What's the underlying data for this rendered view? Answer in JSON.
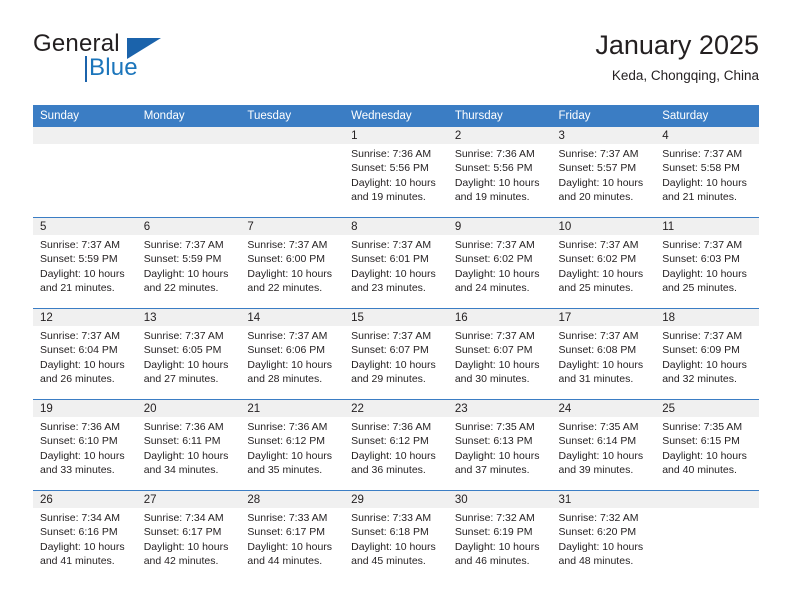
{
  "brand": {
    "word_general": "General",
    "word_blue": "Blue",
    "accent_color": "#1b75bb"
  },
  "header": {
    "title": "January 2025",
    "subtitle": "Keda, Chongqing, China"
  },
  "theme": {
    "header_bg": "#3b7dc4",
    "daynum_bg": "#f0f0f0",
    "text": "#231f20"
  },
  "weekday_headers": [
    "Sunday",
    "Monday",
    "Tuesday",
    "Wednesday",
    "Thursday",
    "Friday",
    "Saturday"
  ],
  "labels": {
    "sunrise_prefix": "Sunrise:",
    "sunset_prefix": "Sunset:",
    "daylight_prefix": "Daylight:"
  },
  "weeks": [
    [
      {
        "day": "",
        "sunrise": "",
        "sunset": "",
        "daylight": "",
        "empty": true
      },
      {
        "day": "",
        "sunrise": "",
        "sunset": "",
        "daylight": "",
        "empty": true
      },
      {
        "day": "",
        "sunrise": "",
        "sunset": "",
        "daylight": "",
        "empty": true
      },
      {
        "day": "1",
        "sunrise": "Sunrise: 7:36 AM",
        "sunset": "Sunset: 5:56 PM",
        "daylight": "Daylight: 10 hours and 19 minutes."
      },
      {
        "day": "2",
        "sunrise": "Sunrise: 7:36 AM",
        "sunset": "Sunset: 5:56 PM",
        "daylight": "Daylight: 10 hours and 19 minutes."
      },
      {
        "day": "3",
        "sunrise": "Sunrise: 7:37 AM",
        "sunset": "Sunset: 5:57 PM",
        "daylight": "Daylight: 10 hours and 20 minutes."
      },
      {
        "day": "4",
        "sunrise": "Sunrise: 7:37 AM",
        "sunset": "Sunset: 5:58 PM",
        "daylight": "Daylight: 10 hours and 21 minutes."
      }
    ],
    [
      {
        "day": "5",
        "sunrise": "Sunrise: 7:37 AM",
        "sunset": "Sunset: 5:59 PM",
        "daylight": "Daylight: 10 hours and 21 minutes."
      },
      {
        "day": "6",
        "sunrise": "Sunrise: 7:37 AM",
        "sunset": "Sunset: 5:59 PM",
        "daylight": "Daylight: 10 hours and 22 minutes."
      },
      {
        "day": "7",
        "sunrise": "Sunrise: 7:37 AM",
        "sunset": "Sunset: 6:00 PM",
        "daylight": "Daylight: 10 hours and 22 minutes."
      },
      {
        "day": "8",
        "sunrise": "Sunrise: 7:37 AM",
        "sunset": "Sunset: 6:01 PM",
        "daylight": "Daylight: 10 hours and 23 minutes."
      },
      {
        "day": "9",
        "sunrise": "Sunrise: 7:37 AM",
        "sunset": "Sunset: 6:02 PM",
        "daylight": "Daylight: 10 hours and 24 minutes."
      },
      {
        "day": "10",
        "sunrise": "Sunrise: 7:37 AM",
        "sunset": "Sunset: 6:02 PM",
        "daylight": "Daylight: 10 hours and 25 minutes."
      },
      {
        "day": "11",
        "sunrise": "Sunrise: 7:37 AM",
        "sunset": "Sunset: 6:03 PM",
        "daylight": "Daylight: 10 hours and 25 minutes."
      }
    ],
    [
      {
        "day": "12",
        "sunrise": "Sunrise: 7:37 AM",
        "sunset": "Sunset: 6:04 PM",
        "daylight": "Daylight: 10 hours and 26 minutes."
      },
      {
        "day": "13",
        "sunrise": "Sunrise: 7:37 AM",
        "sunset": "Sunset: 6:05 PM",
        "daylight": "Daylight: 10 hours and 27 minutes."
      },
      {
        "day": "14",
        "sunrise": "Sunrise: 7:37 AM",
        "sunset": "Sunset: 6:06 PM",
        "daylight": "Daylight: 10 hours and 28 minutes."
      },
      {
        "day": "15",
        "sunrise": "Sunrise: 7:37 AM",
        "sunset": "Sunset: 6:07 PM",
        "daylight": "Daylight: 10 hours and 29 minutes."
      },
      {
        "day": "16",
        "sunrise": "Sunrise: 7:37 AM",
        "sunset": "Sunset: 6:07 PM",
        "daylight": "Daylight: 10 hours and 30 minutes."
      },
      {
        "day": "17",
        "sunrise": "Sunrise: 7:37 AM",
        "sunset": "Sunset: 6:08 PM",
        "daylight": "Daylight: 10 hours and 31 minutes."
      },
      {
        "day": "18",
        "sunrise": "Sunrise: 7:37 AM",
        "sunset": "Sunset: 6:09 PM",
        "daylight": "Daylight: 10 hours and 32 minutes."
      }
    ],
    [
      {
        "day": "19",
        "sunrise": "Sunrise: 7:36 AM",
        "sunset": "Sunset: 6:10 PM",
        "daylight": "Daylight: 10 hours and 33 minutes."
      },
      {
        "day": "20",
        "sunrise": "Sunrise: 7:36 AM",
        "sunset": "Sunset: 6:11 PM",
        "daylight": "Daylight: 10 hours and 34 minutes."
      },
      {
        "day": "21",
        "sunrise": "Sunrise: 7:36 AM",
        "sunset": "Sunset: 6:12 PM",
        "daylight": "Daylight: 10 hours and 35 minutes."
      },
      {
        "day": "22",
        "sunrise": "Sunrise: 7:36 AM",
        "sunset": "Sunset: 6:12 PM",
        "daylight": "Daylight: 10 hours and 36 minutes."
      },
      {
        "day": "23",
        "sunrise": "Sunrise: 7:35 AM",
        "sunset": "Sunset: 6:13 PM",
        "daylight": "Daylight: 10 hours and 37 minutes."
      },
      {
        "day": "24",
        "sunrise": "Sunrise: 7:35 AM",
        "sunset": "Sunset: 6:14 PM",
        "daylight": "Daylight: 10 hours and 39 minutes."
      },
      {
        "day": "25",
        "sunrise": "Sunrise: 7:35 AM",
        "sunset": "Sunset: 6:15 PM",
        "daylight": "Daylight: 10 hours and 40 minutes."
      }
    ],
    [
      {
        "day": "26",
        "sunrise": "Sunrise: 7:34 AM",
        "sunset": "Sunset: 6:16 PM",
        "daylight": "Daylight: 10 hours and 41 minutes."
      },
      {
        "day": "27",
        "sunrise": "Sunrise: 7:34 AM",
        "sunset": "Sunset: 6:17 PM",
        "daylight": "Daylight: 10 hours and 42 minutes."
      },
      {
        "day": "28",
        "sunrise": "Sunrise: 7:33 AM",
        "sunset": "Sunset: 6:17 PM",
        "daylight": "Daylight: 10 hours and 44 minutes."
      },
      {
        "day": "29",
        "sunrise": "Sunrise: 7:33 AM",
        "sunset": "Sunset: 6:18 PM",
        "daylight": "Daylight: 10 hours and 45 minutes."
      },
      {
        "day": "30",
        "sunrise": "Sunrise: 7:32 AM",
        "sunset": "Sunset: 6:19 PM",
        "daylight": "Daylight: 10 hours and 46 minutes."
      },
      {
        "day": "31",
        "sunrise": "Sunrise: 7:32 AM",
        "sunset": "Sunset: 6:20 PM",
        "daylight": "Daylight: 10 hours and 48 minutes."
      },
      {
        "day": "",
        "sunrise": "",
        "sunset": "",
        "daylight": "",
        "empty": true
      }
    ]
  ]
}
